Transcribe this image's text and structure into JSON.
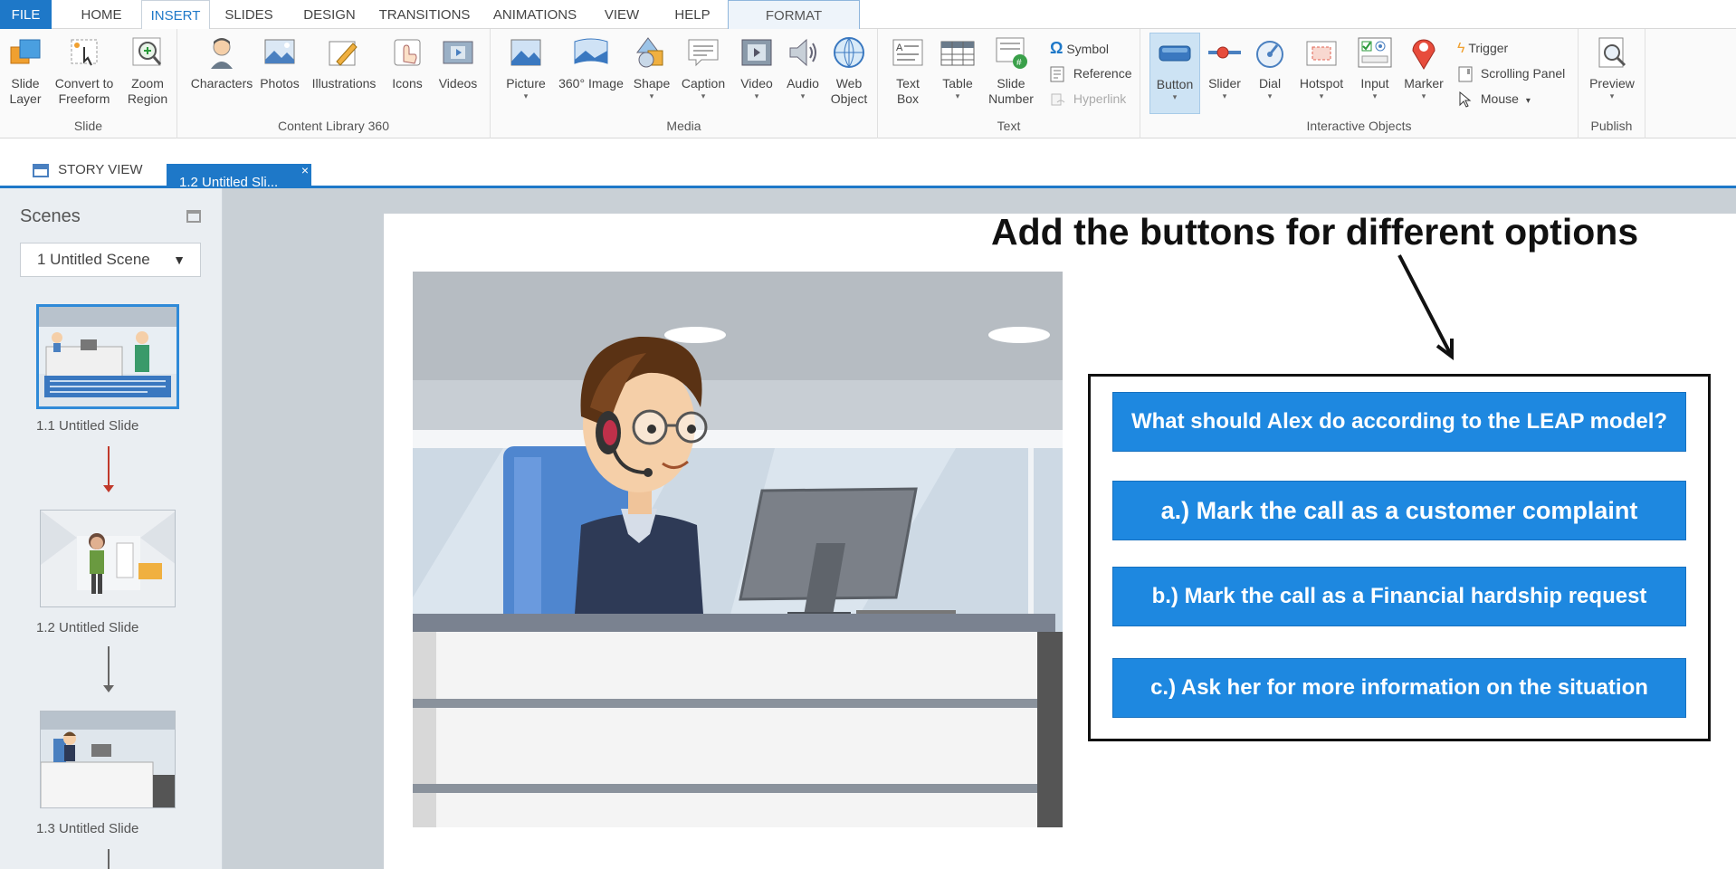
{
  "menu": {
    "tabs": [
      "FILE",
      "HOME",
      "INSERT",
      "SLIDES",
      "DESIGN",
      "TRANSITIONS",
      "ANIMATIONS",
      "VIEW",
      "HELP",
      "FORMAT"
    ]
  },
  "ribbon": {
    "slide_group": {
      "label": "Slide",
      "buttons": [
        {
          "label": "Slide\nLayer",
          "line1": "Slide",
          "line2": "Layer",
          "icon": "slide-layer-icon"
        },
        {
          "label": "Convert to Freeform",
          "line1": "Convert to",
          "line2": "Freeform",
          "icon": "convert-freeform-icon"
        },
        {
          "label": "Zoom Region",
          "line1": "Zoom",
          "line2": "Region",
          "icon": "zoom-region-icon"
        }
      ]
    },
    "content_group": {
      "label": "Content Library 360",
      "buttons": [
        "Characters",
        "Photos",
        "Illustrations",
        "Icons",
        "Videos"
      ]
    },
    "media_group": {
      "label": "Media",
      "buttons": [
        "Picture",
        "360° Image",
        "Shape",
        "Caption",
        "Video",
        "Audio"
      ],
      "web_line1": "Web",
      "web_line2": "Object"
    },
    "text_group": {
      "label": "Text",
      "textbox_line1": "Text",
      "textbox_line2": "Box",
      "table": "Table",
      "slidenum_line1": "Slide",
      "slidenum_line2": "Number",
      "symbol": "Symbol",
      "reference": "Reference",
      "hyperlink": "Hyperlink"
    },
    "interactive_group": {
      "label": "Interactive Objects",
      "buttons": [
        "Button",
        "Slider",
        "Dial",
        "Hotspot",
        "Input",
        "Marker"
      ],
      "trigger": "Trigger",
      "scrolling_panel": "Scrolling Panel",
      "mouse": "Mouse"
    },
    "publish_group": {
      "label": "Publish",
      "preview": "Preview"
    }
  },
  "view_tabs": {
    "story_view": "STORY VIEW",
    "slide_tab": "1.2 Untitled Sli...",
    "close": "×"
  },
  "sidebar": {
    "title": "Scenes",
    "scene_select": "1 Untitled Scene",
    "slides": [
      {
        "label": "1.1 Untitled Slide"
      },
      {
        "label": "1.2 Untitled Slide"
      },
      {
        "label": "1.3 Untitled Slide"
      }
    ]
  },
  "slide": {
    "annotation": "Add the buttons for different options",
    "question": "What should Alex do according to the LEAP model?",
    "option_a": "a.) Mark the call as a customer complaint",
    "option_b": "b.) Mark the call as a Financial hardship request",
    "option_c": "c.) Ask her for more information on the situation"
  },
  "colors": {
    "accent": "#1e78c8",
    "button_blue": "#1e88e0",
    "canvas_gray": "#c9d0d6"
  }
}
